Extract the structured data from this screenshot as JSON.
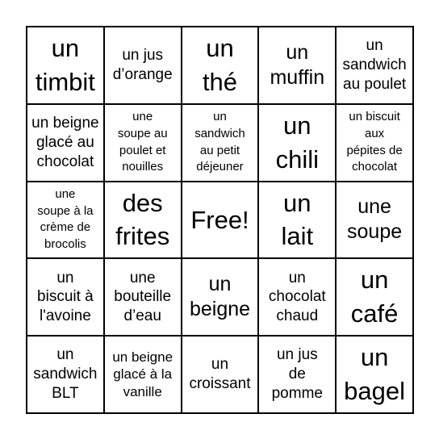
{
  "bingo": {
    "colors": {
      "border": "#000000",
      "cell_background": "#ffffff",
      "text": "#000000"
    },
    "free_label": "Free!",
    "cells": [
      [
        "un timbit",
        "un jus d’orange",
        "un thé",
        "un muffin",
        "un sandwich au poulet"
      ],
      [
        "un beigne glacé au chocolat",
        "une soupe au poulet et nouilles",
        "un sandwich au petit déjeuner",
        "un chili",
        "un biscuit aux pépites de chocolat"
      ],
      [
        "une soupe à la crème de brocolis",
        "des frites",
        "Free!",
        "un lait",
        "une soupe"
      ],
      [
        "un biscuit à l'avoine",
        "une bouteille d’eau",
        "un beigne",
        "un chocolat chaud",
        "un café"
      ],
      [
        "un sandwich BLT",
        "un beigne glacé à la vanille",
        "un croissant",
        "un jus de pomme",
        "un bagel"
      ]
    ],
    "lines": {
      "r0c0": [
        "un",
        "timbit"
      ],
      "r0c1": [
        "un jus",
        "d’orange"
      ],
      "r0c2": [
        "un",
        "thé"
      ],
      "r0c3": [
        "un",
        "muffin"
      ],
      "r0c4": [
        "un",
        "sandwich",
        "au poulet"
      ],
      "r1c0": [
        "un beigne",
        "glacé au",
        "chocolat"
      ],
      "r1c1": [
        "une",
        "soupe au",
        "poulet et",
        "nouilles"
      ],
      "r1c2": [
        "un",
        "sandwich",
        "au petit",
        "déjeuner"
      ],
      "r1c3": [
        "un",
        "chili"
      ],
      "r1c4": [
        "un biscuit",
        "aux",
        "pépites de",
        "chocolat"
      ],
      "r2c0": [
        "une",
        "soupe à la",
        "crème de",
        "brocolis"
      ],
      "r2c1": [
        "des",
        "frites"
      ],
      "r2c2": [
        "Free!"
      ],
      "r2c3": [
        "un",
        "lait"
      ],
      "r2c4": [
        "une",
        "soupe"
      ],
      "r3c0": [
        "un",
        "biscuit à",
        "l'avoine"
      ],
      "r3c1": [
        "une",
        "bouteille",
        "d’eau"
      ],
      "r3c2": [
        "un",
        "beigne"
      ],
      "r3c3": [
        "un",
        "chocolat",
        "chaud"
      ],
      "r3c4": [
        "un",
        "café"
      ],
      "r4c0": [
        "un",
        "sandwich",
        "BLT"
      ],
      "r4c1": [
        "un beigne",
        "glacé à la",
        "vanille"
      ],
      "r4c2": [
        "un",
        "croissant"
      ],
      "r4c3": [
        "un jus",
        "de",
        "pomme"
      ],
      "r4c4": [
        "un",
        "bagel"
      ]
    }
  }
}
